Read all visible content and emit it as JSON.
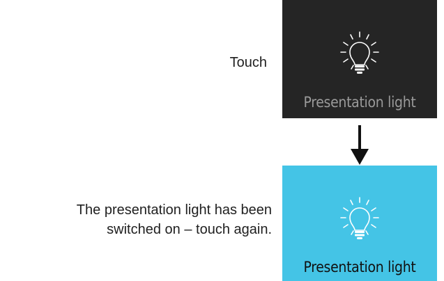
{
  "steps": {
    "step1_instruction": "Touch",
    "step2_instruction": "The presentation light has been switched on – touch again."
  },
  "tiles": {
    "off": {
      "label": "Presentation light",
      "state": "off",
      "icon": "lightbulb-icon",
      "background": "#252525",
      "label_color": "#9a9a9a"
    },
    "on": {
      "label": "Presentation light",
      "state": "on",
      "icon": "lightbulb-icon",
      "background": "#44c4e6",
      "label_color": "#111111"
    }
  },
  "arrow": {
    "icon": "arrow-down-icon"
  }
}
